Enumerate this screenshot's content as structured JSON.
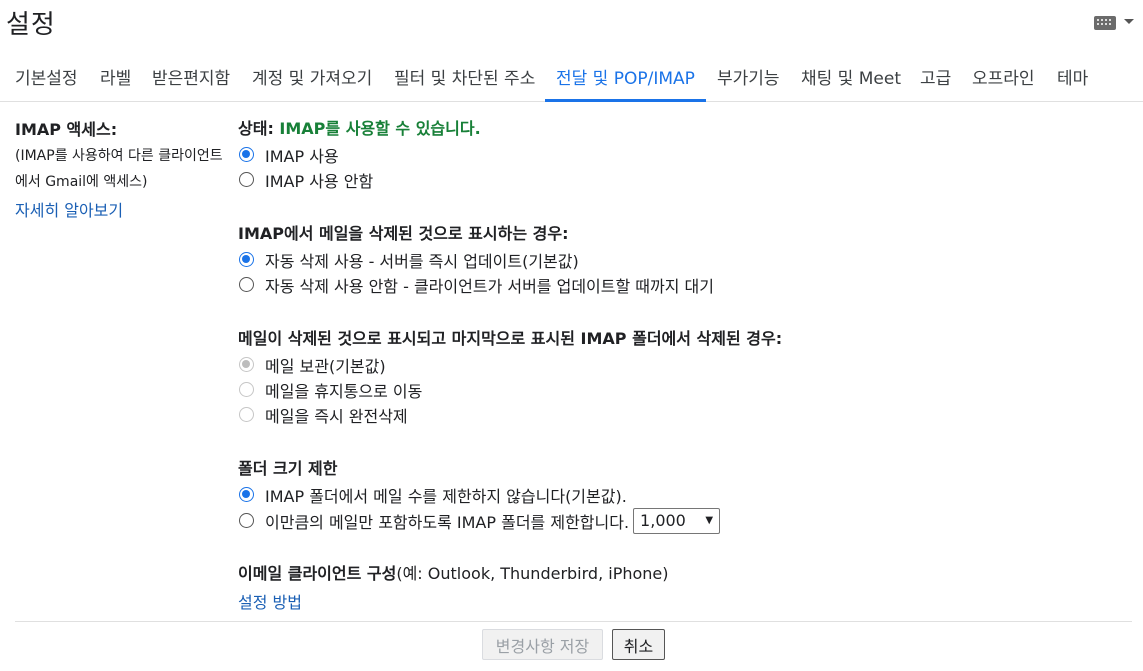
{
  "header": {
    "title": "설정",
    "keyboard_icon": "keyboard-icon",
    "dropdown_icon": "caret-down-icon"
  },
  "tabs": [
    {
      "label": "기본설정"
    },
    {
      "label": "라벨"
    },
    {
      "label": "받은편지함"
    },
    {
      "label": "계정 및 가져오기"
    },
    {
      "label": "필터 및 차단된 주소"
    },
    {
      "label": "전달 및 POP/IMAP"
    },
    {
      "label": "부가기능"
    },
    {
      "label": "채팅 및 Meet"
    },
    {
      "label": "고급"
    },
    {
      "label": "오프라인"
    },
    {
      "label": "테마"
    }
  ],
  "active_tab_index": 5,
  "imap": {
    "label": "IMAP 액세스:",
    "sub_line1": "(IMAP를 사용하여 다른 클라이언트",
    "sub_line2": "에서 Gmail에 액세스)",
    "learn_more": "자세히 알아보기",
    "status_label": "상태:",
    "status_value": "IMAP를 사용할 수 있습니다.",
    "enable": "IMAP 사용",
    "disable": "IMAP 사용 안함"
  },
  "expunge": {
    "title": "IMAP에서 메일을 삭제된 것으로 표시하는 경우:",
    "auto_on": "자동 삭제 사용 - 서버를 즉시 업데이트(기본값)",
    "auto_off": "자동 삭제 사용 안함 - 클라이언트가 서버를 업데이트할 때까지 대기"
  },
  "delete_behavior": {
    "title": "메일이 삭제된 것으로 표시되고 마지막으로 표시된 IMAP 폴더에서 삭제된 경우:",
    "archive": "메일 보관(기본값)",
    "trash": "메일을 휴지통으로 이동",
    "delete_forever": "메일을 즉시 완전삭제"
  },
  "folder_limit": {
    "title": "폴더 크기 제한",
    "no_limit": "IMAP 폴더에서 메일 수를 제한하지 않습니다(기본값).",
    "limit": "이만큼의 메일만 포함하도록 IMAP 폴더를 제한합니다.",
    "selected_value": "1,000"
  },
  "client_config": {
    "title": "이메일 클라이언트 구성",
    "examples": "(예: Outlook, Thunderbird, iPhone)",
    "setup_link": "설정 방법"
  },
  "buttons": {
    "save": "변경사항 저장",
    "cancel": "취소"
  },
  "colors": {
    "accent": "#1a73e8",
    "status_green": "#188038",
    "link": "#1a5fb4"
  }
}
